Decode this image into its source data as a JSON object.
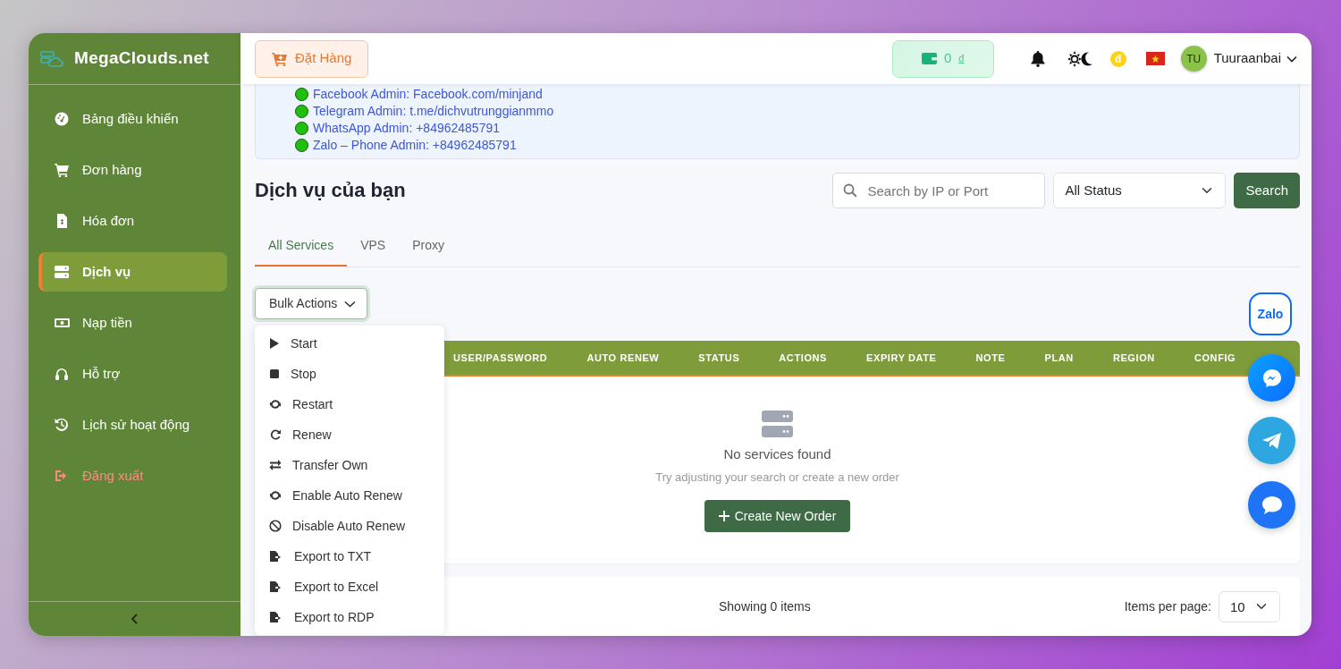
{
  "brand": {
    "name": "MegaClouds.net"
  },
  "sidebar": {
    "items": [
      {
        "label": "Bảng điều khiển",
        "kind": "nav",
        "selected": false
      },
      {
        "label": "Đơn hàng",
        "kind": "nav",
        "selected": false
      },
      {
        "label": "Hóa đơn",
        "kind": "nav",
        "selected": false
      },
      {
        "label": "Dịch vụ",
        "kind": "nav",
        "selected": true
      },
      {
        "label": "Nạp tiền",
        "kind": "nav",
        "selected": false
      },
      {
        "label": "Hỗ trợ",
        "kind": "nav",
        "selected": false
      },
      {
        "label": "Lịch sử hoạt động",
        "kind": "nav",
        "selected": false
      },
      {
        "label": "Đăng xuất",
        "kind": "logout",
        "selected": false
      }
    ]
  },
  "header": {
    "order_button": "Đặt Hàng",
    "balance": "0",
    "currency": "đ",
    "coin_symbol": "đ",
    "avatar_initials": "TU",
    "user_name": "Tuuraanbai"
  },
  "contacts": [
    {
      "text": "Facebook Admin: Facebook.com/minjand"
    },
    {
      "text": "Telegram Admin: t.me/dichvutrunggianmmo"
    },
    {
      "text": "WhatsApp Admin: +84962485791"
    },
    {
      "text": "Zalo – Phone Admin: +84962485791"
    }
  ],
  "page_title": "Dịch vụ của bạn",
  "search": {
    "placeholder": "Search by IP or Port"
  },
  "status_filter": {
    "value": "All Status"
  },
  "search_button": "Search",
  "tabs": [
    {
      "label": "All Services",
      "selected": true
    },
    {
      "label": "VPS",
      "selected": false
    },
    {
      "label": "Proxy",
      "selected": false
    }
  ],
  "bulk_actions": {
    "label": "Bulk Actions",
    "expanded": true,
    "items": [
      "Start",
      "Stop",
      "Restart",
      "Renew",
      "Transfer Own",
      "Enable Auto Renew",
      "Disable Auto Renew",
      "Export to TXT",
      "Export to Excel",
      "Export to RDP"
    ]
  },
  "table": {
    "columns": [
      "USER/PASSWORD",
      "AUTO RENEW",
      "STATUS",
      "ACTIONS",
      "EXPIRY DATE",
      "NOTE",
      "PLAN",
      "REGION",
      "CONFIG"
    ]
  },
  "empty_state": {
    "title": "No services found",
    "subtitle": "Try adjusting your search or create a new order",
    "button": "Create New Order"
  },
  "pagination": {
    "summary": "Showing 0 items",
    "per_page_label": "Items per page:",
    "per_page_value": "10"
  },
  "floating": {
    "zalo_label": "Zalo"
  }
}
